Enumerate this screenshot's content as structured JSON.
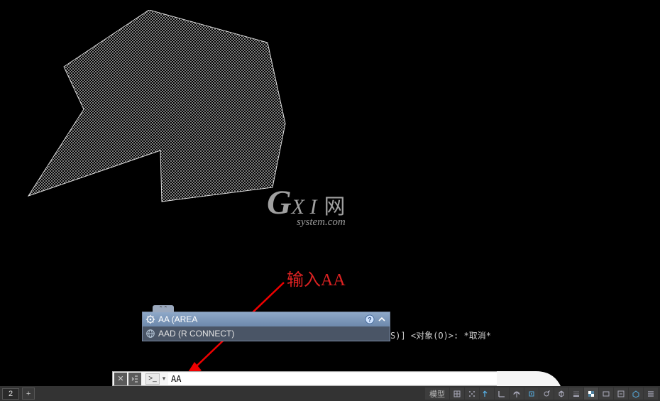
{
  "watermark": {
    "big": "G",
    "mid": "X I",
    "cn": "网",
    "sub": "system.com"
  },
  "annotation": {
    "label": "输入AA"
  },
  "autocomplete": {
    "handle": "⌃⌃",
    "header": {
      "icon": "gear-icon",
      "text": "AA (AREA"
    },
    "items": [
      {
        "icon": "globe-icon",
        "text": "AAD (R  CONNECT)"
      }
    ]
  },
  "command_log": "S)] <对象(O)>: *取消*",
  "commandline": {
    "close": "✕",
    "opts": "🔧",
    "prompt_icon": ">_",
    "dropdown": "▾",
    "value": "AA"
  },
  "statusbar": {
    "left_number": "2",
    "plus": "+",
    "model_label": "模型",
    "icons": [
      "grid-icon",
      "snap-icon",
      "limit-icon",
      "wall-icon",
      "angle-icon",
      "target-icon",
      "rotate-icon",
      "box-icon",
      "pencil-icon",
      "monitor-icon",
      "square-icon",
      "tray-icon",
      "door-icon",
      "bolt-icon"
    ]
  },
  "colors": {
    "accent_blue": "#6d89ac",
    "annotation_red": "#d22"
  }
}
